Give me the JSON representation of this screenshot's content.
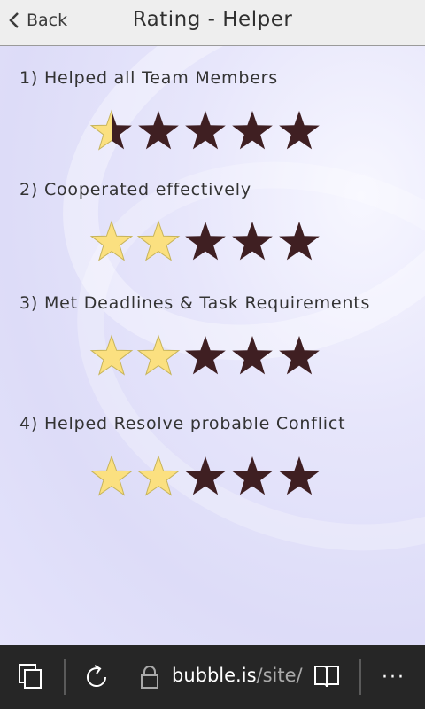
{
  "header": {
    "back_label": "Back",
    "title": "Rating - Helper"
  },
  "questions": [
    {
      "label": "1) Helped all Team Members",
      "rating": 0.5,
      "max": 5
    },
    {
      "label": "2) Cooperated effectively",
      "rating": 2,
      "max": 5
    },
    {
      "label": "3) Met Deadlines & Task Requirements",
      "rating": 2,
      "max": 5
    },
    {
      "label": "4) Helped Resolve probable Conflict",
      "rating": 2,
      "max": 5
    }
  ],
  "colors": {
    "star_filled": "#fbe080",
    "star_empty": "#3f1f22",
    "star_outline": "#c7b45a"
  },
  "browser": {
    "url_domain": "bubble.is",
    "url_path": "/site/",
    "icons": [
      "tabs-icon",
      "refresh-icon",
      "lock-icon",
      "reader-icon",
      "more-icon"
    ],
    "more_label": "···"
  }
}
